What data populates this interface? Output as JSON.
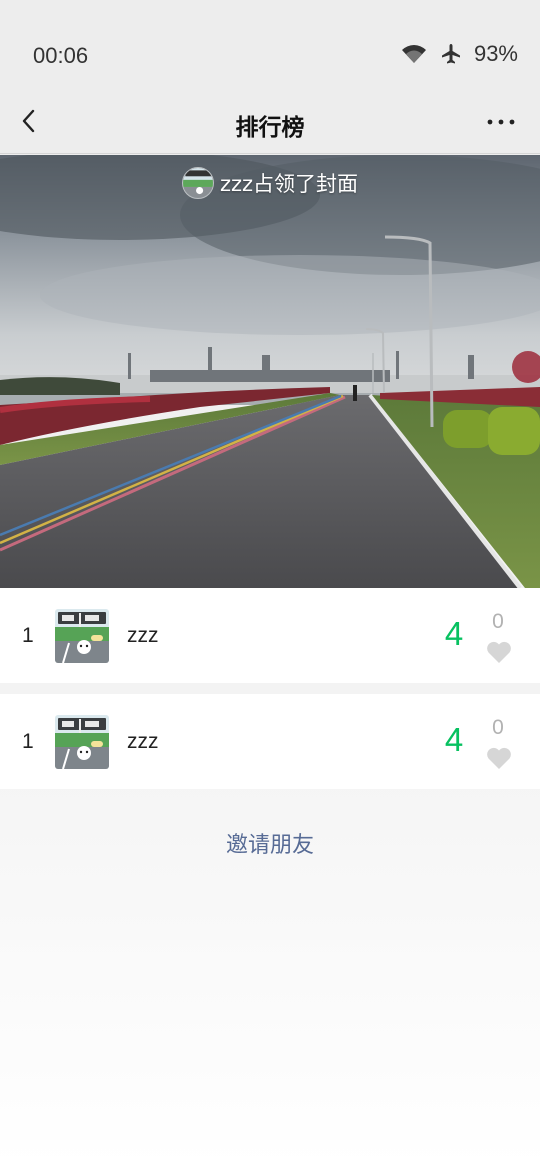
{
  "status_bar": {
    "time": "00:06",
    "battery": "93%",
    "icons": [
      "wifi-icon",
      "airplane-icon"
    ]
  },
  "nav": {
    "title": "排行榜",
    "back_icon": "chevron-left-icon",
    "more_icon": "more-icon"
  },
  "cover": {
    "caption": "zzz占领了封面"
  },
  "ranking": [
    {
      "rank": "1",
      "name": "zzz",
      "steps": "4",
      "likes": "0"
    },
    {
      "rank": "1",
      "name": "zzz",
      "steps": "4",
      "likes": "0"
    }
  ],
  "footer": {
    "invite_label": "邀请朋友"
  },
  "colors": {
    "steps": "#07c160",
    "like": "#b2b2b2",
    "link": "#576b95"
  }
}
